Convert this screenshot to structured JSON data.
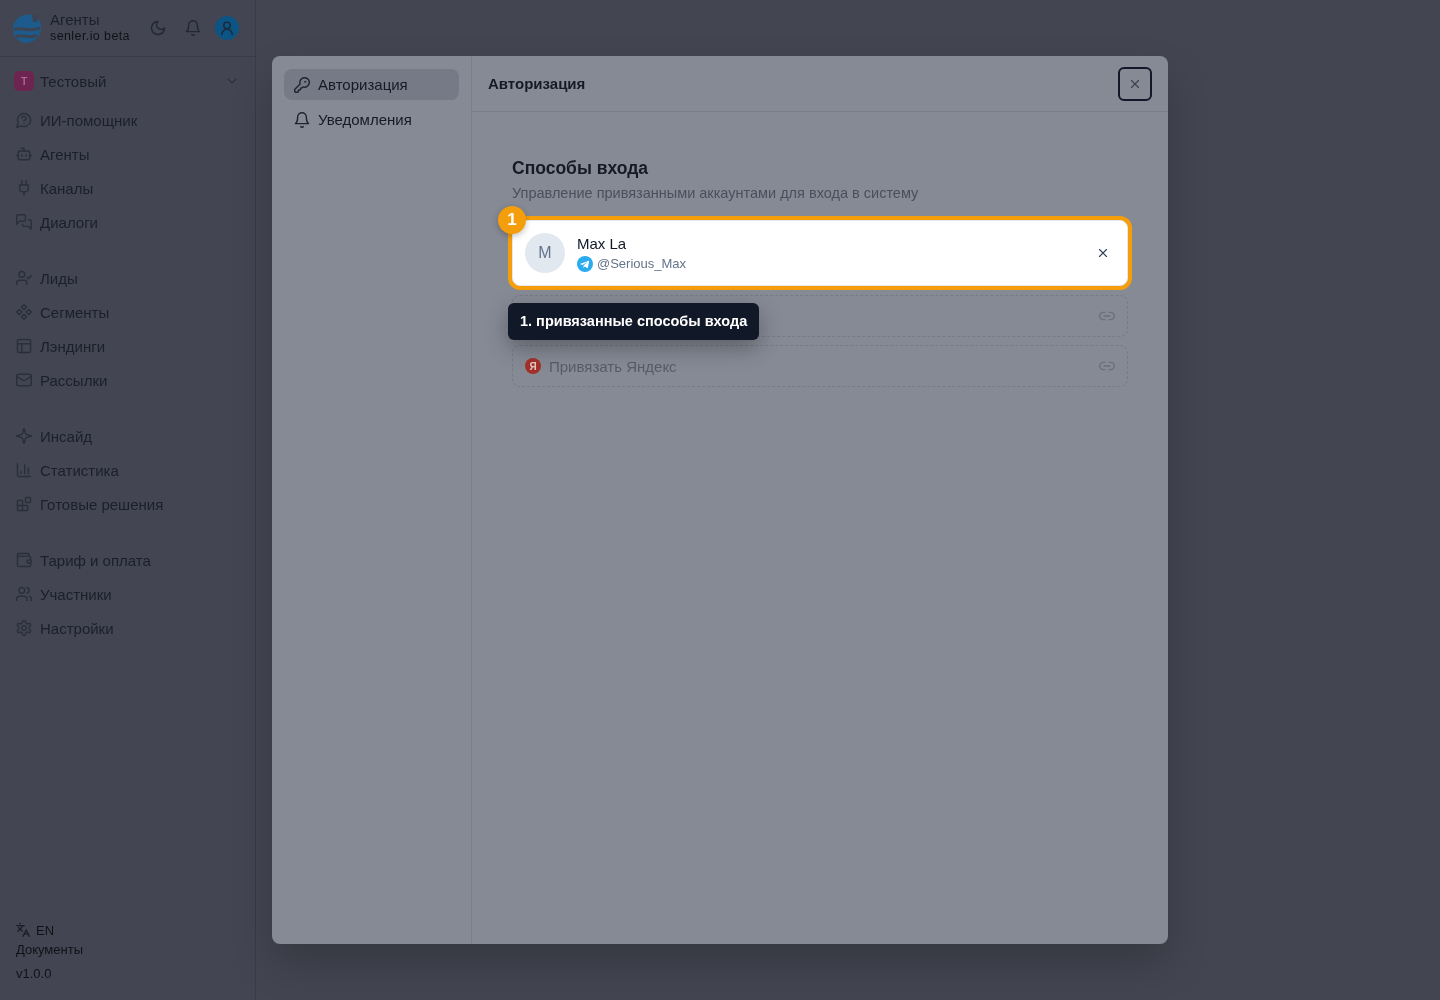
{
  "app": {
    "title": "Агенты",
    "subtitle": "senler.io beta"
  },
  "workspace": {
    "initial": "Т",
    "name": "Тестовый"
  },
  "sidebar": {
    "groups": [
      {
        "items": [
          {
            "label": "ИИ-помощник",
            "selected": false
          },
          {
            "label": "Агенты",
            "selected": false
          },
          {
            "label": "Каналы",
            "selected": false
          },
          {
            "label": "Диалоги",
            "selected": false
          }
        ]
      },
      {
        "items": [
          {
            "label": "Лиды",
            "selected": false
          },
          {
            "label": "Сегменты",
            "selected": false
          },
          {
            "label": "Лэндинги",
            "selected": false
          },
          {
            "label": "Рассылки",
            "selected": false
          }
        ]
      },
      {
        "items": [
          {
            "label": "Инсайд",
            "selected": false
          },
          {
            "label": "Статистика",
            "selected": false
          },
          {
            "label": "Готовые решения",
            "selected": false
          }
        ]
      },
      {
        "items": [
          {
            "label": "Тариф и оплата",
            "selected": false
          },
          {
            "label": "Участники",
            "selected": false
          },
          {
            "label": "Настройки",
            "selected": false
          }
        ]
      }
    ]
  },
  "footer": {
    "language": "EN",
    "docs": "Документы",
    "version": "v1.0.0"
  },
  "dialog": {
    "nav": [
      {
        "label": "Авторизация",
        "selected": true
      },
      {
        "label": "Уведомления",
        "selected": false
      }
    ],
    "title": "Авторизация",
    "close_focused": true,
    "section": {
      "title": "Способы входа",
      "subtitle": "Управление привязанными аккаунтами для входа в систему"
    },
    "methods": [
      {
        "kind": "linked",
        "initial": "M",
        "name": "Max La",
        "handle": "@Serious_Max",
        "highlighted": true
      },
      {
        "kind": "link",
        "highlighted": false
      },
      {
        "kind": "link",
        "logo": "Я",
        "label": "Привязать Яндекс",
        "highlighted": false
      }
    ]
  },
  "tour": {
    "step": "1",
    "text": "1. привязанные способы входа"
  }
}
